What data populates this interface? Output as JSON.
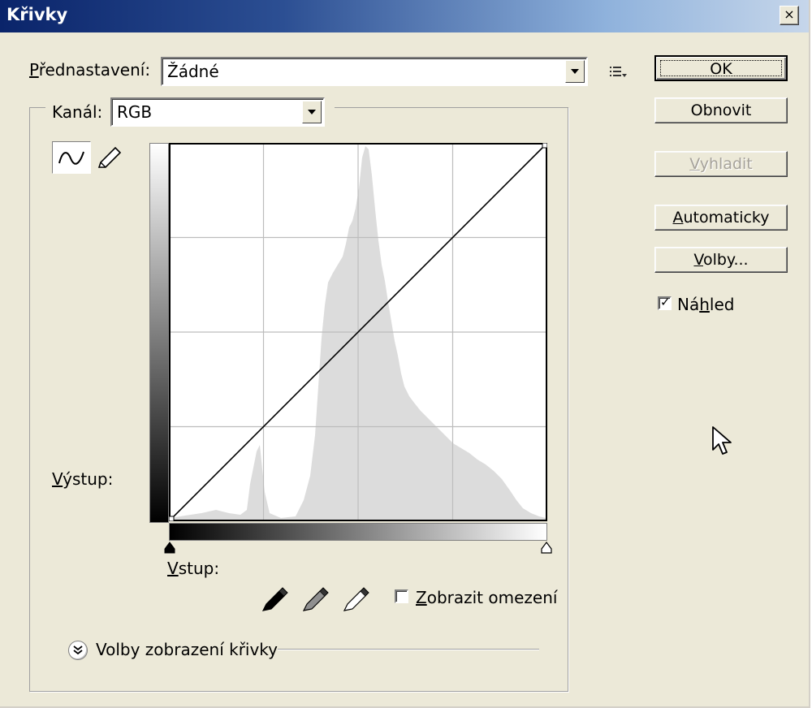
{
  "window": {
    "title": "Křivky",
    "close_label": "×"
  },
  "preset": {
    "label_first": "P",
    "label_rest": "řednastavení:",
    "value": "Žádné"
  },
  "channel": {
    "label": "Kanál:",
    "value": "RGB"
  },
  "buttons": {
    "ok": "OK",
    "reset": "Obnovit",
    "smooth_first": "V",
    "smooth_rest": "yhladit",
    "auto_first": "A",
    "auto_rest": "utomaticky",
    "options_first": "V",
    "options_rest": "olby..."
  },
  "preview": {
    "label_a": "Ná",
    "label_u": "h",
    "label_b": "led",
    "checked": true
  },
  "graph": {
    "output_first": "V",
    "output_rest": "ýstup:",
    "input_first": "V",
    "input_rest": "stup:"
  },
  "clipping": {
    "label_first": "Z",
    "label_rest": "obrazit omezení",
    "checked": false
  },
  "curve_display_options": {
    "label": "Volby zobrazení křivky"
  },
  "curve": {
    "points": [
      [
        0,
        0
      ],
      [
        255,
        255
      ]
    ]
  },
  "icons": [
    "curve-tool-icon",
    "pencil-tool-icon",
    "preset-menu-icon",
    "black-eyedropper-icon",
    "gray-eyedropper-icon",
    "white-eyedropper-icon",
    "expand-chevron-icon",
    "mouse-cursor-icon"
  ]
}
